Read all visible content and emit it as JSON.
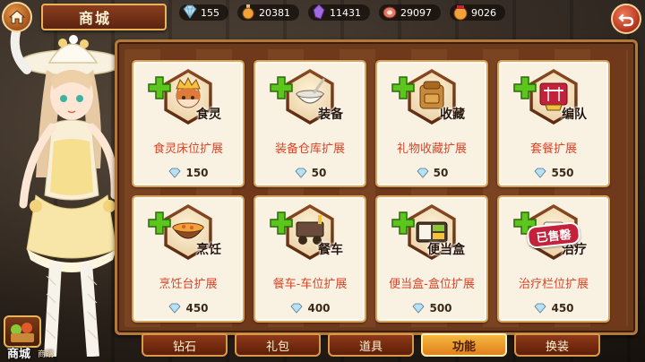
{
  "header": {
    "title": "商城",
    "resources": [
      {
        "name": "diamond",
        "icon": "diamond-icon",
        "value": "155"
      },
      {
        "name": "potion",
        "icon": "potion-bottle-icon",
        "value": "20381"
      },
      {
        "name": "crystal",
        "icon": "purple-crystal-icon",
        "value": "11431"
      },
      {
        "name": "meat",
        "icon": "meat-icon",
        "value": "29097"
      },
      {
        "name": "bag",
        "icon": "pouch-icon",
        "value": "9026"
      }
    ]
  },
  "cards": [
    {
      "tag": "食灵",
      "title": "食灵床位扩展",
      "price": "150",
      "sold": ""
    },
    {
      "tag": "装备",
      "title": "装备仓库扩展",
      "price": "50",
      "sold": ""
    },
    {
      "tag": "收藏",
      "title": "礼物收藏扩展",
      "price": "50",
      "sold": ""
    },
    {
      "tag": "编队",
      "title": "套餐扩展",
      "price": "550",
      "sold": ""
    },
    {
      "tag": "烹饪",
      "title": "烹饪台扩展",
      "price": "450",
      "sold": ""
    },
    {
      "tag": "餐车",
      "title": "餐车-车位扩展",
      "price": "400",
      "sold": ""
    },
    {
      "tag": "便当盒",
      "title": "便当盒-盒位扩展",
      "price": "500",
      "sold": ""
    },
    {
      "tag": "治疗",
      "title": "治疗栏位扩展",
      "price": "450",
      "sold": "已售罄"
    }
  ],
  "tabs": [
    {
      "label": "钻石",
      "active": false
    },
    {
      "label": "礼包",
      "active": false
    },
    {
      "label": "道具",
      "active": false
    },
    {
      "label": "功能",
      "active": true
    },
    {
      "label": "换装",
      "active": false
    }
  ],
  "shop_badge": {
    "label": "商城",
    "sub": "商購"
  },
  "colors": {
    "accent_orange": "#e0801c",
    "card_title_red": "#d8462a",
    "panel_brown": "#6b3a1c",
    "plus_green": "#5cc61e"
  }
}
